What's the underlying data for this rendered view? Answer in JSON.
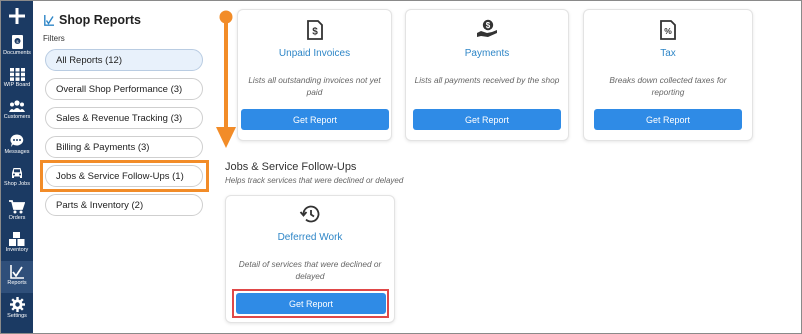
{
  "nav": {
    "items": [
      {
        "label": "Documents",
        "icon": "document-icon"
      },
      {
        "label": "WIP Board",
        "icon": "grid-icon"
      },
      {
        "label": "Customers",
        "icon": "people-icon"
      },
      {
        "label": "Messages",
        "icon": "chat-icon"
      },
      {
        "label": "Shop Jobs",
        "icon": "car-icon"
      },
      {
        "label": "Orders",
        "icon": "cart-icon"
      },
      {
        "label": "Inventory",
        "icon": "boxes-icon"
      },
      {
        "label": "Reports",
        "icon": "chart-icon"
      },
      {
        "label": "Settings",
        "icon": "gear-icon"
      }
    ]
  },
  "panel": {
    "title": "Shop Reports",
    "filters_label": "Filters",
    "filters": [
      {
        "label": "All Reports (12)"
      },
      {
        "label": "Overall Shop Performance (3)"
      },
      {
        "label": "Sales & Revenue Tracking (3)"
      },
      {
        "label": "Billing & Payments (3)"
      },
      {
        "label": "Jobs & Service Follow-Ups (1)"
      },
      {
        "label": "Parts & Inventory (2)"
      }
    ]
  },
  "top_cards": [
    {
      "title": "Unpaid Invoices",
      "desc": "Lists all outstanding invoices not yet paid",
      "button": "Get Report",
      "icon": "dollar-document-icon"
    },
    {
      "title": "Payments",
      "desc": "Lists all payments received by the shop",
      "button": "Get Report",
      "icon": "hand-dollar-icon"
    },
    {
      "title": "Tax",
      "desc": "Breaks down collected taxes for reporting",
      "button": "Get Report",
      "icon": "percent-document-icon"
    }
  ],
  "section": {
    "title": "Jobs & Service Follow-Ups",
    "subtitle": "Helps track services that were declined or delayed"
  },
  "section_card": {
    "title": "Deferred Work",
    "desc": "Detail of services that were declined or delayed",
    "button": "Get Report",
    "icon": "history-icon"
  },
  "colors": {
    "nav_bg": "#1b3a63",
    "accent": "#2f8be6",
    "link": "#2e86c7",
    "highlight_orange": "#f28c28",
    "highlight_red": "#e04848"
  }
}
